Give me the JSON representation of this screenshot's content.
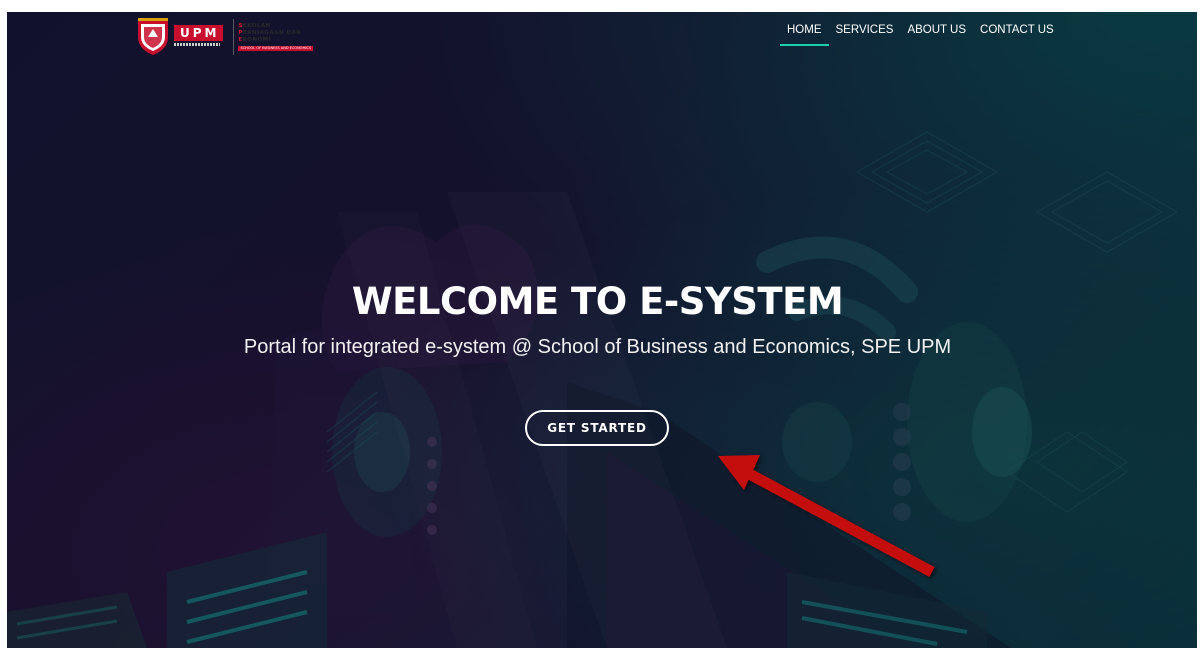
{
  "header": {
    "logo": {
      "brand": "UPM",
      "faculty_lines": [
        "SEKOLAH",
        "PERNIAGAAN DAN",
        "EKONOMI"
      ],
      "faculty_tag": "SCHOOL OF BUSINESS AND ECONOMICS"
    },
    "nav": [
      {
        "label": "HOME",
        "active": true
      },
      {
        "label": "SERVICES",
        "active": false
      },
      {
        "label": "ABOUT US",
        "active": false
      },
      {
        "label": "CONTACT US",
        "active": false
      }
    ]
  },
  "hero": {
    "title": "WELCOME TO E-SYSTEM",
    "subtitle": "Portal for integrated e-system @ School of Business and Economics, SPE UPM",
    "cta_label": "GET STARTED"
  },
  "annotation": {
    "icon": "red-arrow-icon",
    "color": "#c40c0c"
  },
  "colors": {
    "nav_active_underline": "#18d0a8",
    "brand_red": "#c8102e"
  }
}
